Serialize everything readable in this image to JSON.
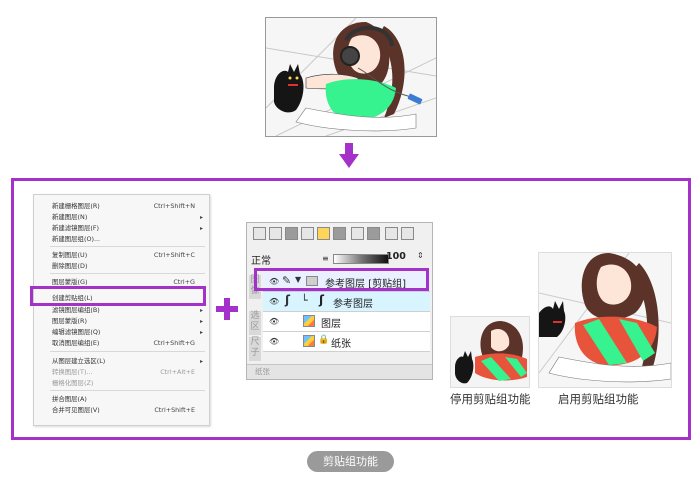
{
  "context_menu": {
    "items": [
      {
        "label": "新建栅格图层(R)",
        "shortcut": "Ctrl+Shift+N",
        "submenu": false,
        "disabled": false
      },
      {
        "label": "新建图层(N)",
        "shortcut": "",
        "submenu": true,
        "disabled": false
      },
      {
        "label": "新建滤镜图层(F)",
        "shortcut": "",
        "submenu": true,
        "disabled": false
      },
      {
        "label": "新建图层组(O)...",
        "shortcut": "",
        "submenu": false,
        "disabled": false
      },
      {
        "label": "复制图层(U)",
        "shortcut": "Ctrl+Shift+C",
        "submenu": false,
        "disabled": false
      },
      {
        "label": "删除图层(D)",
        "shortcut": "",
        "submenu": false,
        "disabled": false
      },
      {
        "label": "图层蒙版(G)",
        "shortcut": "Ctrl+G",
        "submenu": false,
        "disabled": false
      },
      {
        "label": "创建剪贴组(L)",
        "shortcut": "",
        "submenu": false,
        "disabled": false
      },
      {
        "label": "滤镜图层编组(B)",
        "shortcut": "",
        "submenu": true,
        "disabled": false
      },
      {
        "label": "图层蒙版(R)",
        "shortcut": "",
        "submenu": true,
        "disabled": false
      },
      {
        "label": "编辑滤镜图层(Q)",
        "shortcut": "",
        "submenu": true,
        "disabled": false
      },
      {
        "label": "取消图层编组(E)",
        "shortcut": "Ctrl+Shift+G",
        "submenu": false,
        "disabled": false
      },
      {
        "label": "从图层建立选区(L)",
        "shortcut": "",
        "submenu": true,
        "disabled": false
      },
      {
        "label": "转换图层(T)...",
        "shortcut": "Ctrl+Alt+E",
        "submenu": false,
        "disabled": true
      },
      {
        "label": "栅格化图层(Z)",
        "shortcut": "",
        "submenu": false,
        "disabled": true
      },
      {
        "label": "拼合图层(A)",
        "shortcut": "",
        "submenu": false,
        "disabled": false
      },
      {
        "label": "合并可见图层(V)",
        "shortcut": "Ctrl+Shift+E",
        "submenu": false,
        "disabled": false
      }
    ]
  },
  "layer_panel": {
    "blend_mode": "正常",
    "opacity": "100",
    "side_tabs": [
      "图像",
      "选区",
      "尺子"
    ],
    "layers": [
      {
        "name": "参考图层 [剪贴组]"
      },
      {
        "name": "参考图层"
      },
      {
        "name": "图层"
      },
      {
        "name": "纸张"
      }
    ],
    "status": "纸张"
  },
  "results": {
    "disabled_caption": "停用剪贴组功能",
    "enabled_caption": "启用剪贴组功能"
  },
  "footer": {
    "label": "剪贴组功能"
  },
  "colors": {
    "accent": "#a431c9",
    "top_suit": "#36f28f",
    "clip_red": "#e8533b"
  },
  "icons": [
    "down-arrow-icon",
    "plus-icon",
    "eye-icon",
    "brush-icon",
    "folder-icon",
    "lock-icon",
    "chain-icon"
  ]
}
